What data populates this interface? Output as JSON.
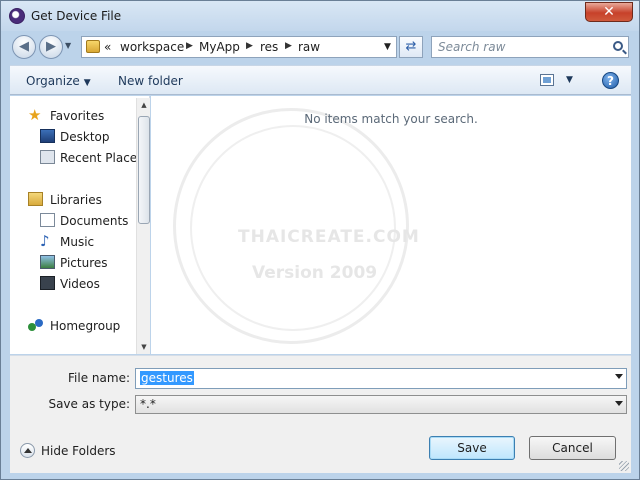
{
  "window": {
    "title": "Get Device File",
    "close_glyph": "✕"
  },
  "address_bar": {
    "overflow_glyph": "«",
    "crumbs": [
      "workspace",
      "MyApp",
      "res",
      "raw"
    ]
  },
  "search": {
    "placeholder": "Search raw"
  },
  "toolbar": {
    "organize_label": "Organize",
    "new_folder_label": "New folder",
    "help_glyph": "?"
  },
  "nav_pane": {
    "favorites": {
      "label": "Favorites",
      "items": [
        "Desktop",
        "Recent Places"
      ]
    },
    "libraries": {
      "label": "Libraries",
      "items": [
        "Documents",
        "Music",
        "Pictures",
        "Videos"
      ]
    },
    "homegroup": {
      "label": "Homegroup"
    }
  },
  "content": {
    "empty_message": "No items match your search.",
    "watermark": {
      "line1": "THAICREATE.COM",
      "line2": "Version 2009"
    }
  },
  "form": {
    "file_name_label": "File name:",
    "file_name_value": "gestures",
    "save_as_type_label": "Save as type:",
    "save_as_type_value": "*.*"
  },
  "footer": {
    "hide_folders_label": "Hide Folders",
    "save_label": "Save",
    "cancel_label": "Cancel"
  }
}
